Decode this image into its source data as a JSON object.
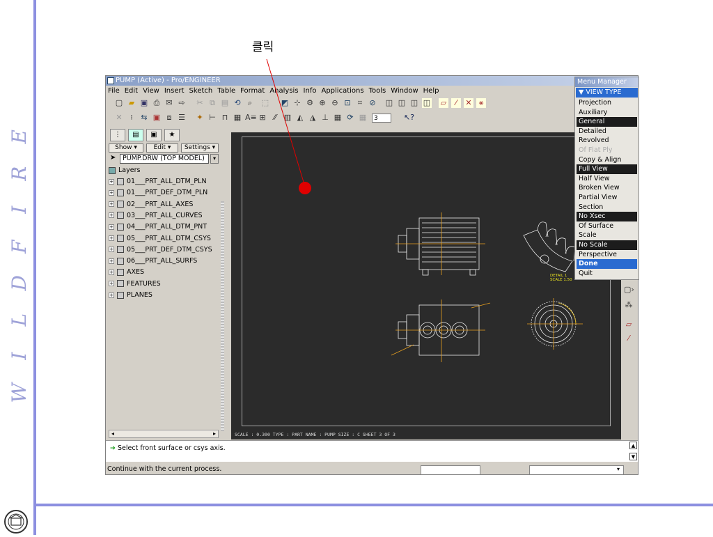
{
  "slide": {
    "click_label": "클릭",
    "side_title_letters": [
      "W",
      "I",
      "L",
      "D",
      "F",
      "I",
      "R",
      "E"
    ],
    "accent_color": "#8c8fe0"
  },
  "window": {
    "title": "PUMP (Active) - Pro/ENGINEER",
    "menus": [
      "File",
      "Edit",
      "View",
      "Insert",
      "Sketch",
      "Table",
      "Format",
      "Analysis",
      "Info",
      "Applications",
      "Tools",
      "Window",
      "Help"
    ],
    "spin_value": "3"
  },
  "left_panel": {
    "show_label": "Show",
    "edit_label": "Edit",
    "settings_label": "Settings",
    "model_select": "PUMP.DRW (TOP MODEL)",
    "tree_root": "Layers",
    "tree_items": [
      "01___PRT_ALL_DTM_PLN",
      "01___PRT_DEF_DTM_PLN",
      "02___PRT_ALL_AXES",
      "03___PRT_ALL_CURVES",
      "04___PRT_ALL_DTM_PNT",
      "05___PRT_ALL_DTM_CSYS",
      "05___PRT_DEF_DTM_CSYS",
      "06___PRT_ALL_SURFS",
      "AXES",
      "FEATURES",
      "PLANES"
    ]
  },
  "drawing": {
    "footer": "SCALE : 0.300    TYPE : PART    NAME : PUMP   SIZE : C     SHEET 3  OF 3",
    "detail_note": "DETAIL  1",
    "scale_note": "SCALE  1.50"
  },
  "status": {
    "message": "Select front surface or csys axis.",
    "bottom": "Continue with the current process."
  },
  "menu_manager": {
    "title": "Menu Manager",
    "header": "VIEW TYPE",
    "items": [
      {
        "label": "Projection",
        "state": "normal"
      },
      {
        "label": "Auxiliary",
        "state": "normal"
      },
      {
        "label": "General",
        "state": "selected"
      },
      {
        "label": "Detailed",
        "state": "normal"
      },
      {
        "label": "Revolved",
        "state": "normal"
      },
      {
        "label": "Of Flat Ply",
        "state": "disabled"
      },
      {
        "label": "Copy & Align",
        "state": "normal"
      },
      {
        "label": "Full View",
        "state": "selected"
      },
      {
        "label": "Half View",
        "state": "normal"
      },
      {
        "label": "Broken View",
        "state": "normal"
      },
      {
        "label": "Partial View",
        "state": "normal"
      },
      {
        "label": "Section",
        "state": "normal"
      },
      {
        "label": "No Xsec",
        "state": "selected"
      },
      {
        "label": "Of Surface",
        "state": "normal"
      },
      {
        "label": "Scale",
        "state": "normal"
      },
      {
        "label": "No Scale",
        "state": "selected"
      },
      {
        "label": "Perspective",
        "state": "normal"
      },
      {
        "label": "Done",
        "state": "done"
      },
      {
        "label": "Quit",
        "state": "normal"
      }
    ]
  }
}
